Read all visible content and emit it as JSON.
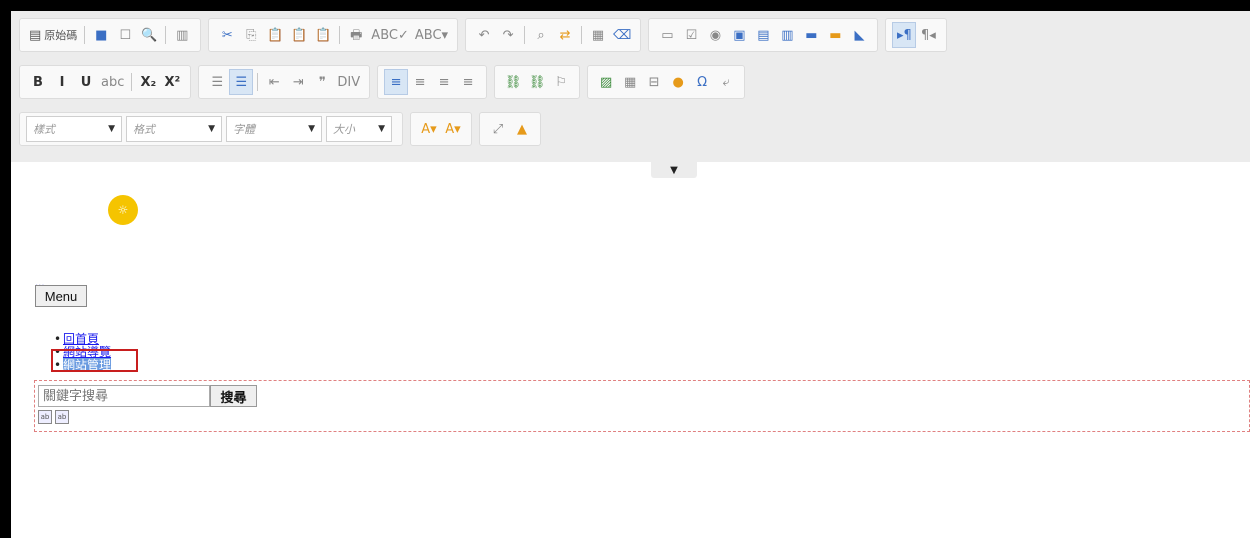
{
  "toolbar": {
    "row1": [
      [
        {
          "name": "source-button",
          "label": "原始碼",
          "icon": "▤"
        },
        {
          "sep": true
        },
        {
          "name": "save-icon",
          "icon": "■",
          "cls": "blue"
        },
        {
          "name": "new-page-icon",
          "icon": "☐",
          "cls": "gray"
        },
        {
          "name": "preview-icon",
          "icon": "🔍",
          "cls": "gray"
        },
        {
          "sep": true
        },
        {
          "name": "templates-icon",
          "icon": "▥",
          "cls": "gray"
        }
      ],
      [
        {
          "name": "cut-icon",
          "icon": "✂",
          "cls": "blue"
        },
        {
          "name": "copy-icon",
          "icon": "⎘",
          "cls": "gray"
        },
        {
          "name": "paste-icon",
          "icon": "📋",
          "cls": "orange"
        },
        {
          "name": "paste-text-icon",
          "icon": "📋",
          "cls": "orange"
        },
        {
          "name": "paste-word-icon",
          "icon": "📋",
          "cls": "blue"
        },
        {
          "sep": true
        },
        {
          "name": "print-icon",
          "icon": "🖶",
          "cls": "gray"
        },
        {
          "name": "spellcheck-icon",
          "icon": "ABC✓",
          "cls": "gray"
        },
        {
          "name": "scayt-icon",
          "icon": "ABC▾",
          "cls": "gray"
        }
      ],
      [
        {
          "name": "undo-icon",
          "icon": "↶",
          "cls": "gray"
        },
        {
          "name": "redo-icon",
          "icon": "↷",
          "cls": "gray"
        },
        {
          "sep": true
        },
        {
          "name": "find-icon",
          "icon": "⌕",
          "cls": "gray"
        },
        {
          "name": "replace-icon",
          "icon": "⇄",
          "cls": "orange"
        },
        {
          "sep": true
        },
        {
          "name": "select-all-icon",
          "icon": "▦",
          "cls": "gray"
        },
        {
          "name": "remove-format-icon",
          "icon": "⌫",
          "cls": "blue"
        }
      ],
      [
        {
          "name": "form-icon",
          "icon": "▭",
          "cls": "gray"
        },
        {
          "name": "checkbox-icon",
          "icon": "☑",
          "cls": "gray"
        },
        {
          "name": "radio-icon",
          "icon": "◉",
          "cls": "gray"
        },
        {
          "name": "textfield-icon",
          "icon": "▣",
          "cls": "blue"
        },
        {
          "name": "textarea-icon",
          "icon": "▤",
          "cls": "blue"
        },
        {
          "name": "select-icon",
          "icon": "▥",
          "cls": "blue"
        },
        {
          "name": "button-icon",
          "icon": "▬",
          "cls": "blue"
        },
        {
          "name": "image-button-icon",
          "icon": "▬",
          "cls": "orange"
        },
        {
          "name": "hidden-field-icon",
          "icon": "◣",
          "cls": "blue"
        }
      ],
      [
        {
          "name": "ltr-icon",
          "icon": "▸¶",
          "cls": "blue",
          "on": true
        },
        {
          "name": "rtl-icon",
          "icon": "¶◂",
          "cls": "gray"
        }
      ]
    ],
    "row2": [
      [
        {
          "name": "bold-button",
          "icon": "B",
          "cls": "bold"
        },
        {
          "name": "italic-button",
          "icon": "I",
          "cls": "bold"
        },
        {
          "name": "underline-button",
          "icon": "U",
          "cls": "bold"
        },
        {
          "name": "strike-button",
          "icon": "abc",
          "cls": "gray"
        },
        {
          "sep": true
        },
        {
          "name": "subscript-button",
          "icon": "X₂",
          "cls": "bold"
        },
        {
          "name": "superscript-button",
          "icon": "X²",
          "cls": "bold"
        }
      ],
      [
        {
          "name": "numbered-list-icon",
          "icon": "☰",
          "cls": "gray"
        },
        {
          "name": "bulleted-list-icon",
          "icon": "☰",
          "cls": "blue",
          "on": true
        },
        {
          "sep": true
        },
        {
          "name": "outdent-icon",
          "icon": "⇤",
          "cls": "gray"
        },
        {
          "name": "indent-icon",
          "icon": "⇥",
          "cls": "gray"
        },
        {
          "name": "blockquote-icon",
          "icon": "❞",
          "cls": "gray"
        },
        {
          "name": "div-icon",
          "icon": "DIV",
          "cls": "gray"
        }
      ],
      [
        {
          "name": "align-left-icon",
          "icon": "≡",
          "cls": "blue",
          "on": true
        },
        {
          "name": "align-center-icon",
          "icon": "≡",
          "cls": "gray"
        },
        {
          "name": "align-right-icon",
          "icon": "≡",
          "cls": "gray"
        },
        {
          "name": "justify-icon",
          "icon": "≡",
          "cls": "gray"
        }
      ],
      [
        {
          "name": "link-icon",
          "icon": "⛓",
          "cls": "green"
        },
        {
          "name": "unlink-icon",
          "icon": "⛓",
          "cls": "green"
        },
        {
          "name": "anchor-icon",
          "icon": "⚐",
          "cls": "gray"
        }
      ],
      [
        {
          "name": "image-icon",
          "icon": "▨",
          "cls": "green"
        },
        {
          "name": "table-icon",
          "icon": "▦",
          "cls": "gray"
        },
        {
          "name": "horizontal-rule-icon",
          "icon": "⊟",
          "cls": "gray"
        },
        {
          "name": "smiley-icon",
          "icon": "●",
          "cls": "orange"
        },
        {
          "name": "special-char-icon",
          "icon": "Ω",
          "cls": "blue"
        },
        {
          "name": "page-break-icon",
          "icon": "⤶",
          "cls": "gray"
        }
      ]
    ],
    "row3": {
      "combos": [
        {
          "name": "styles-combo",
          "label": "樣式",
          "width": 96
        },
        {
          "name": "format-combo",
          "label": "格式",
          "width": 96
        },
        {
          "name": "font-combo",
          "label": "字體",
          "width": 96
        },
        {
          "name": "size-combo",
          "label": "大小",
          "width": 66
        }
      ],
      "colors": [
        {
          "name": "text-color-icon",
          "icon": "A▾",
          "cls": "orange"
        },
        {
          "name": "bg-color-icon",
          "icon": "A▾",
          "cls": "orange"
        }
      ],
      "tools": [
        {
          "name": "maximize-icon",
          "icon": "⤢",
          "cls": "gray"
        },
        {
          "name": "show-blocks-icon",
          "icon": "▲",
          "cls": "orange"
        }
      ]
    },
    "collapse_icon": "▼"
  },
  "content": {
    "logo_glyph": "☼",
    "dots_link": "...",
    "menu_label": "Menu",
    "nav": [
      "回首頁",
      "網站導覽",
      "網站管理"
    ],
    "search": {
      "placeholder": "關鍵字搜尋",
      "button": "搜尋",
      "mini_icons": [
        "ab",
        "ab"
      ]
    }
  }
}
